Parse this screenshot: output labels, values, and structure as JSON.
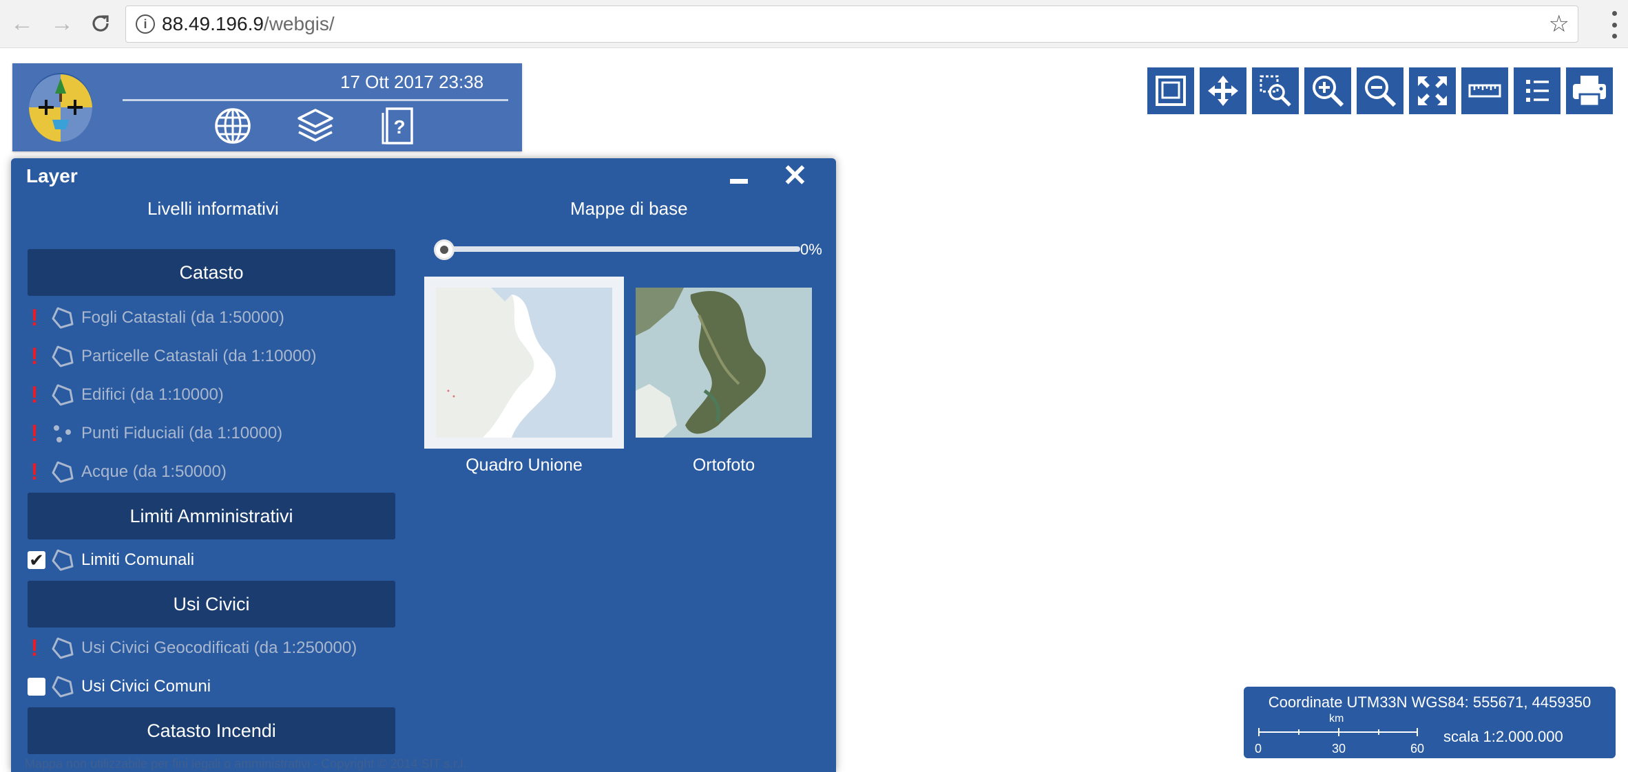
{
  "browser": {
    "url_host": "88.49.196.9",
    "url_path": "/webgis/"
  },
  "header": {
    "datetime": "17 Ott 2017 23:38",
    "icons": [
      "globe-icon",
      "layers-icon",
      "help-manual-icon"
    ]
  },
  "toolbar": {
    "buttons": [
      "full-extent",
      "pan",
      "zoom-box",
      "zoom-in",
      "zoom-out",
      "fullscreen",
      "measure",
      "legend",
      "print"
    ]
  },
  "layer_panel": {
    "title": "Layer",
    "left_heading": "Livelli informativi",
    "right_heading": "Mappe di base",
    "groups": {
      "catasto": {
        "label": "Catasto",
        "items": [
          {
            "label": "Fogli Catastali (da 1:50000)",
            "state": "unavailable"
          },
          {
            "label": "Particelle Catastali (da 1:10000)",
            "state": "unavailable"
          },
          {
            "label": "Edifici (da 1:10000)",
            "state": "unavailable"
          },
          {
            "label": "Punti Fiduciali (da 1:10000)",
            "state": "unavailable"
          },
          {
            "label": "Acque  (da 1:50000)",
            "state": "unavailable"
          }
        ]
      },
      "limiti": {
        "label": "Limiti Amministrativi",
        "items": [
          {
            "label": "Limiti Comunali",
            "state": "checked"
          }
        ]
      },
      "usi_civici": {
        "label": "Usi Civici",
        "items": [
          {
            "label": "Usi Civici Geocodificati (da 1:250000)",
            "state": "unavailable"
          },
          {
            "label": "Usi Civici Comuni",
            "state": "unchecked"
          }
        ]
      },
      "incendi": {
        "label": "Catasto Incendi"
      }
    },
    "basemaps": {
      "transparency": "0%",
      "transparency_value": 0,
      "items": [
        {
          "label": "Quadro Unione",
          "selected": true
        },
        {
          "label": "Ortofoto",
          "selected": false
        }
      ]
    },
    "footer_note": "Mappa non utilizzabile per fini legali o amministrativi - Copyright © 2014 SIT s.r.l."
  },
  "status": {
    "coordinates": "Coordinate UTM33N WGS84: 555671, 4459350",
    "scale_unit": "km",
    "scale_ticks": [
      "0",
      "30",
      "60"
    ],
    "scale_ratio": "scala 1:2.000.000"
  },
  "colors": {
    "panel": "#2a5a9f",
    "group_header": "#1a3c6e",
    "header": "#4870b4",
    "warning": "#e41f2a"
  }
}
